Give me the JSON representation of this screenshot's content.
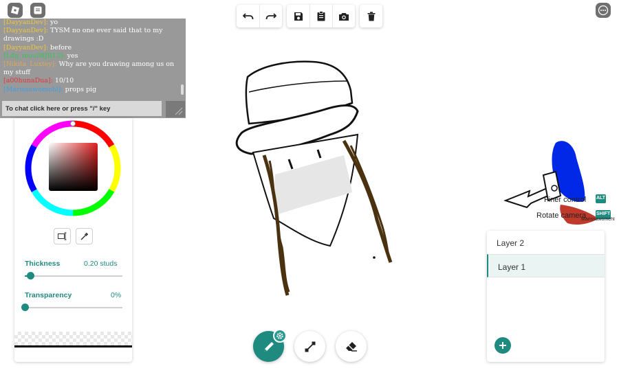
{
  "chat": {
    "messages": [
      {
        "user": "[DayyanDev]:",
        "text": "yo",
        "color": "#f0c63a"
      },
      {
        "user": "[DayyanDev]:",
        "text": "TYSM no one ever said that to my drawings :D",
        "color": "#f0c63a"
      },
      {
        "user": "[DayyanDev]:",
        "text": "before",
        "color": "#f0c63a"
      },
      {
        "user": "[Ldg_mou08JB13]:",
        "text": "yes",
        "color": "#36c45a"
      },
      {
        "user": "[Nikita_Luxtey]:",
        "text": "Why are you drawing among us on my stuff",
        "color": "#d9a85a"
      },
      {
        "user": "[a00hunaDua]:",
        "text": "10/10",
        "color": "#e0333a"
      },
      {
        "user": "[Marissawomehl]:",
        "text": "props pig",
        "color": "#3aa0e8"
      }
    ],
    "input_placeholder": "To chat click here or press \"/\" key"
  },
  "toolbar": {
    "undo_icon": "undo-icon",
    "redo_icon": "redo-icon",
    "save_icon": "save-icon",
    "clipboard_icon": "clipboard-icon",
    "camera_icon": "camera-icon",
    "delete_icon": "trash-icon"
  },
  "brush": {
    "thickness_label": "Thickness",
    "thickness_value": "0.20 studs",
    "thickness_level": 0.06,
    "transparency_label": "Transparency",
    "transparency_value": "0%",
    "transparency_level": 0.0,
    "accent": "#1f8a80"
  },
  "layers": {
    "items": [
      {
        "label": "Layer 2",
        "active": false
      },
      {
        "label": "Layer 1",
        "active": true
      }
    ]
  },
  "world": {
    "finer_control": "Finer control",
    "finer_key": "ALT",
    "rotate_camera": "Rotate camera",
    "rotate_key": "SHIFT",
    "player_name": "Marissawomehl"
  },
  "tools": [
    {
      "name": "pencil",
      "active": true
    },
    {
      "name": "line",
      "active": false
    },
    {
      "name": "eraser",
      "active": false
    }
  ]
}
